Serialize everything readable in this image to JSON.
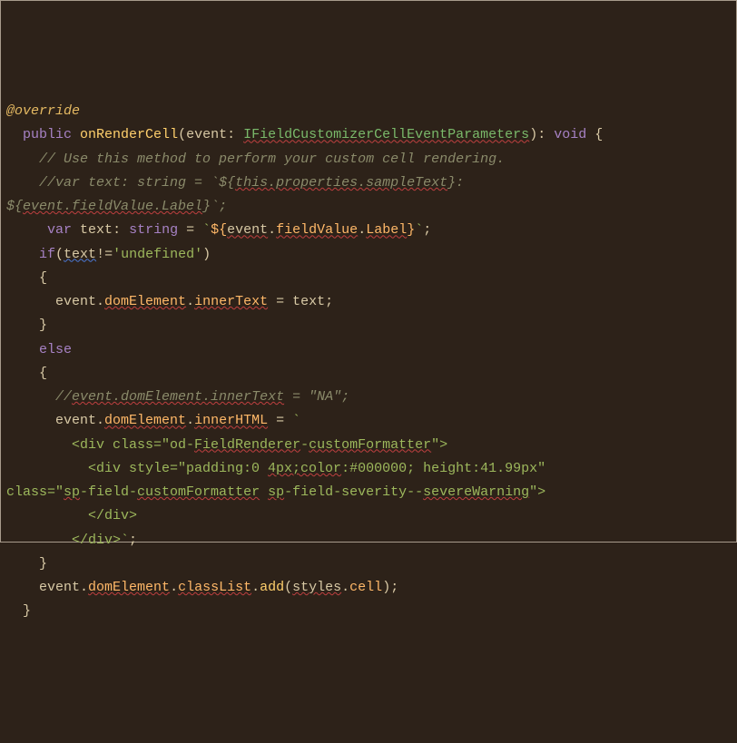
{
  "code": {
    "t0": "@override",
    "t1": "public",
    "t2": "onRenderCell",
    "t3": "(",
    "t4": "event",
    "t5": ": ",
    "t6": "IFieldCustomizerCellEventParameters",
    "t7": "): ",
    "t8": "void",
    "t9": " {",
    "t10": "// Use this method to perform your custom cell rendering.",
    "t11": "//var text: string = `${",
    "t11b": "this.properties.sampleText",
    "t11c": "}:",
    "t12": "${",
    "t12b": "event.fieldValue.Label",
    "t12c": "}`;",
    "t13": "var",
    "t14": "text",
    "t15": ": ",
    "t16": "string",
    "t17": " = ",
    "t18": "`",
    "t19": "${",
    "t20": "event",
    "t21": ".",
    "t22": "fieldValue",
    "t23": ".",
    "t24": "Label",
    "t25": "}",
    "t26": "`",
    "t27": ";",
    "t28": "if",
    "t29": "(",
    "t30": "text",
    "t31": "!=",
    "t32": "'undefined'",
    "t33": ")",
    "t34": "{",
    "t35": "event",
    "t36": ".",
    "t37": "domElement",
    "t38": ".",
    "t39": "innerText",
    "t40": " = ",
    "t41": "text",
    "t42": ";",
    "t43": "}",
    "t44": "else",
    "t45": "{",
    "t46": "//",
    "t46b": "event.domElement.innerText",
    "t46c": " = \"NA\";",
    "t47": "event",
    "t48": ".",
    "t49": "domElement",
    "t50": ".",
    "t51": "innerHTML",
    "t52": " = ",
    "t53": "`",
    "t54": "        <div class=\"od-",
    "t54b": "FieldRenderer",
    "t54c": "-",
    "t54d": "customFormatter",
    "t54e": "\">",
    "t55": "          <div style=\"padding:0 ",
    "t55b": "4px;color",
    "t55c": ":#000000; height:41.99px\"",
    "t56": "class=\"",
    "t56b": "sp",
    "t56c": "-field-",
    "t56d": "customFormatter",
    "t56e": " ",
    "t56f": "sp",
    "t56g": "-field-severity--",
    "t56h": "severeWarning",
    "t56i": "\">",
    "t57": "          </div>",
    "t58": "        </div>`",
    "t59": ";",
    "t60": "}",
    "t61": "event",
    "t62": ".",
    "t63": "domElement",
    "t64": ".",
    "t65": "classList",
    "t66": ".",
    "t67": "add",
    "t68": "(",
    "t69": "styles",
    "t70": ".",
    "t71": "cell",
    "t72": ");",
    "t73": "}"
  }
}
